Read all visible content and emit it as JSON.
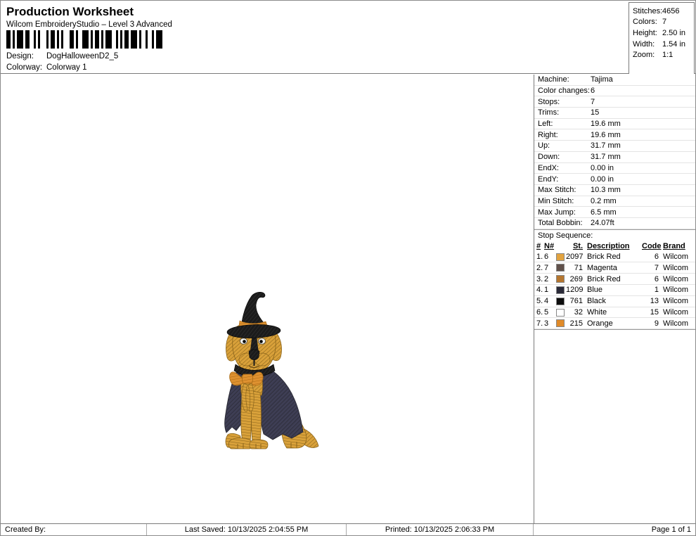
{
  "header": {
    "title": "Production Worksheet",
    "subtitle": "Wilcom EmbroideryStudio – Level 3 Advanced",
    "design_label": "Design:",
    "design_value": "DogHalloweenD2_5",
    "colorway_label": "Colorway:",
    "colorway_value": "Colorway 1"
  },
  "stats": {
    "rows": [
      {
        "label": "Stitches:",
        "value": "4656"
      },
      {
        "label": "Colors:",
        "value": "7"
      },
      {
        "label": "Height:",
        "value": "2.50 in"
      },
      {
        "label": "Width:",
        "value": "1.54 in"
      },
      {
        "label": "Zoom:",
        "value": "1:1"
      }
    ]
  },
  "machine_info": {
    "rows": [
      {
        "label": "Machine:",
        "value": "Tajima"
      },
      {
        "label": "Color changes:",
        "value": "6"
      },
      {
        "label": "Stops:",
        "value": "7"
      },
      {
        "label": "Trims:",
        "value": "15"
      },
      {
        "label": "Left:",
        "value": "19.6 mm"
      },
      {
        "label": "Right:",
        "value": "19.6 mm"
      },
      {
        "label": "Up:",
        "value": "31.7 mm"
      },
      {
        "label": "Down:",
        "value": "31.7 mm"
      },
      {
        "label": "EndX:",
        "value": "0.00 in"
      },
      {
        "label": "EndY:",
        "value": "0.00 in"
      },
      {
        "label": "Max Stitch:",
        "value": "10.3 mm"
      },
      {
        "label": "Min Stitch:",
        "value": "0.2 mm"
      },
      {
        "label": "Max Jump:",
        "value": "6.5 mm"
      },
      {
        "label": "Total Bobbin:",
        "value": "24.07ft"
      }
    ]
  },
  "stop_sequence": {
    "title": "Stop Sequence:",
    "columns": {
      "num": "#",
      "n": "N#",
      "st": "St.",
      "description": "Description",
      "code": "Code",
      "brand": "Brand"
    },
    "rows": [
      {
        "num": "1.",
        "n": "6",
        "color": "#E2A33F",
        "st": "2097",
        "description": "Brick Red",
        "code": "6",
        "brand": "Wilcom"
      },
      {
        "num": "2.",
        "n": "7",
        "color": "#60504A",
        "st": "71",
        "description": "Magenta",
        "code": "7",
        "brand": "Wilcom"
      },
      {
        "num": "3.",
        "n": "2",
        "color": "#B5762F",
        "st": "269",
        "description": "Brick Red",
        "code": "6",
        "brand": "Wilcom"
      },
      {
        "num": "4.",
        "n": "1",
        "color": "#2A2A38",
        "st": "1209",
        "description": "Blue",
        "code": "1",
        "brand": "Wilcom"
      },
      {
        "num": "5.",
        "n": "4",
        "color": "#0D0D0D",
        "st": "761",
        "description": "Black",
        "code": "13",
        "brand": "Wilcom"
      },
      {
        "num": "6.",
        "n": "5",
        "color": "#FFFFFF",
        "st": "32",
        "description": "White",
        "code": "15",
        "brand": "Wilcom"
      },
      {
        "num": "7.",
        "n": "3",
        "color": "#E08A28",
        "st": "215",
        "description": "Orange",
        "code": "9",
        "brand": "Wilcom"
      }
    ]
  },
  "footer": {
    "created_by": "Created By:",
    "last_saved": "Last Saved: 10/13/2025 2:04:55 PM",
    "printed": "Printed: 10/13/2025 2:06:33 PM",
    "page": "Page 1 of 1"
  },
  "design_preview": {
    "name": "dog in witch hat and cape embroidery"
  },
  "design_palette": {
    "gold": "#D9A13A",
    "gold_dark": "#8A641B",
    "navy": "#3E3E54",
    "navy_dark": "#26262F",
    "black": "#1B1B1B",
    "black_hi": "#3A3A3A",
    "orange": "#DE9130",
    "orange_dark": "#A96A15",
    "white": "#F5F5F0"
  }
}
